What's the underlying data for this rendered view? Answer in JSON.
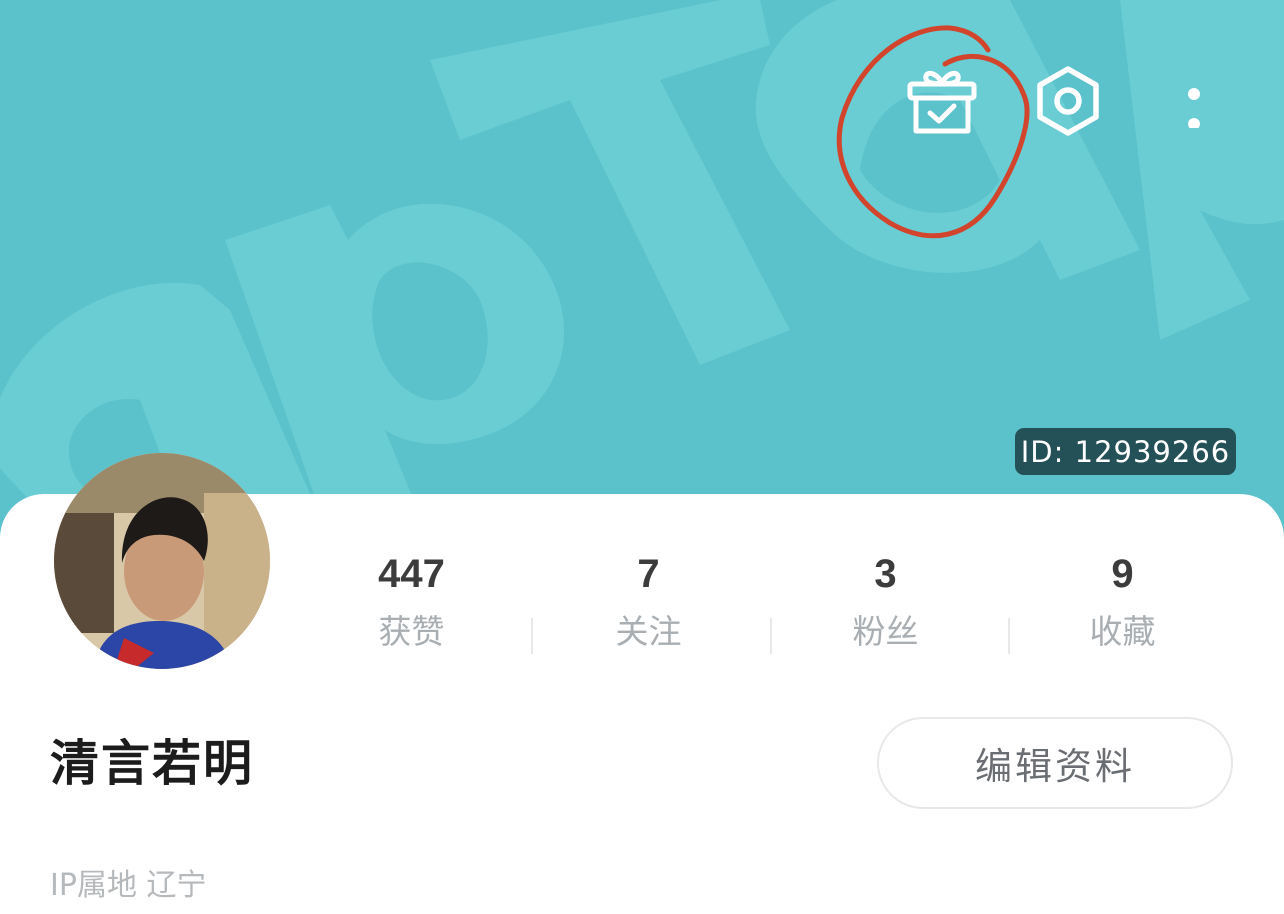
{
  "header": {
    "watermark_text": "apTap",
    "gift_icon": "gift-check-icon",
    "settings_icon": "hexagon-gear-icon",
    "more_icon": "more-vertical-icon",
    "id_badge": "ID: 12939266"
  },
  "profile": {
    "avatar_alt": "user-avatar-photo",
    "username": "清言若明",
    "edit_label": "编辑资料",
    "ip_location": "IP属地 辽宁"
  },
  "stats": [
    {
      "value": "447",
      "label": "获赞"
    },
    {
      "value": "7",
      "label": "关注"
    },
    {
      "value": "3",
      "label": "粉丝"
    },
    {
      "value": "9",
      "label": "收藏"
    }
  ],
  "colors": {
    "banner": "#5bc1cb",
    "watermark": "#69cdd3",
    "id_badge_bg": "#245157",
    "annotation": "#d2452c",
    "stat_value": "#3c3c3c",
    "stat_label": "#a9aeb2"
  }
}
